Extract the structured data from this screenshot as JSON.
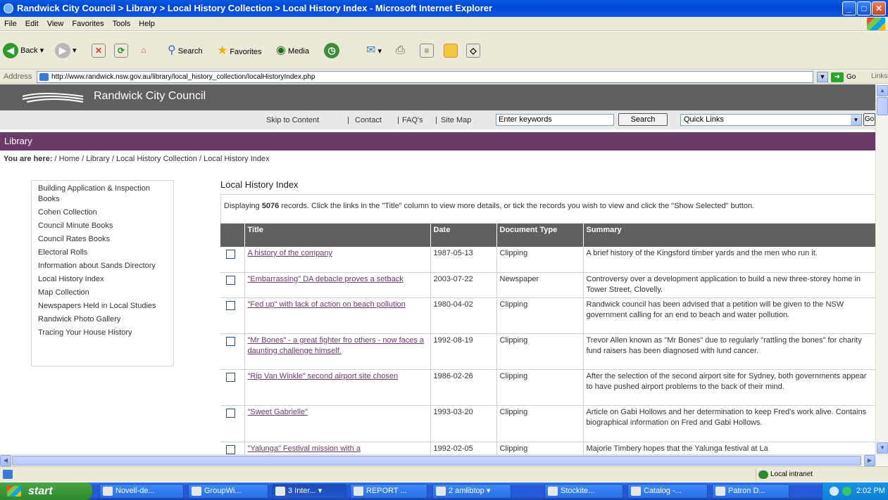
{
  "window": {
    "title": "Randwick City Council > Library > Local History Collection > Local History Index - Microsoft Internet Explorer"
  },
  "menu": [
    "File",
    "Edit",
    "View",
    "Favorites",
    "Tools",
    "Help"
  ],
  "toolbar": {
    "back": "Back",
    "search": "Search",
    "favorites": "Favorites",
    "media": "Media"
  },
  "address": {
    "label": "Address",
    "url": "http://www.randwick.nsw.gov.au/library/local_history_collection/localHistoryIndex.php",
    "go": "Go",
    "links": "Links"
  },
  "site": {
    "name": "Randwick City Council",
    "util": {
      "skip": "Skip to Content",
      "contact": "Contact",
      "faq": "FAQ's",
      "sitemap": "Site Map"
    },
    "search_value": "Enter keywords",
    "search_button": "Search",
    "quick_links": "Quick Links",
    "go_button": "Go",
    "section": "Library",
    "breadcrumb": {
      "label": "You are here:",
      "items": [
        "Home",
        "Library",
        "Local History Collection",
        "Local History Index"
      ]
    }
  },
  "sidebar": {
    "items": [
      "Building Application & Inspection Books",
      "Cohen Collection",
      "Council Minute Books",
      "Council Rates Books",
      "Electoral Rolls",
      "Information about Sands Directory",
      "Local History Index",
      "Map Collection",
      "Newspapers Held in Local Studies",
      "Randwick Photo Gallery",
      "Tracing Your House History"
    ]
  },
  "main": {
    "title": "Local History Index",
    "intro_prefix": "Displaying ",
    "record_count": "5076",
    "intro_suffix": " records. Click the links in the \"Title\" column to view more details, or tick the records you wish to view and click the \"Show Selected\" button.",
    "columns": {
      "title": "Title",
      "date": "Date",
      "doctype": "Document Type",
      "summary": "Summary"
    },
    "rows": [
      {
        "title": "A history of the company",
        "date": "1987-05-13",
        "type": "Clipping",
        "summary": "A brief history of the Kingsford timber yards and the men who run it."
      },
      {
        "title": "\"Embarrassing\" DA debacle proves a setback",
        "date": "2003-07-22",
        "type": "Newspaper",
        "summary": "Controversy over a development application to build a new three-storey home in Tower Street, Clovelly."
      },
      {
        "title": "\"Fed up\" with lack of action on beach pollution",
        "date": "1980-04-02",
        "type": "Clipping",
        "summary": "Randwick council has been advised that a petition will be given to the NSW government calling for an end to beach and water pollution."
      },
      {
        "title": "\"Mr Bones\" - a great fighter fro others - now faces a daunting challenge himself.",
        "date": "1992-08-19",
        "type": "Clipping",
        "summary": "Trevor Allen known as \"Mr Bones\" due to regularly \"rattling the bones\" for charity fund raisers has been diagnosed with lund cancer."
      },
      {
        "title": "\"Rip Van Winkle\" second airport site chosen",
        "date": "1986-02-26",
        "type": "Clipping",
        "summary": "After the selection of the second airport site for Sydney, both governments appear to have pushed airport problems to the back of their mind."
      },
      {
        "title": "\"Sweet Gabrielle\"",
        "date": "1993-03-20",
        "type": "Clipping",
        "summary": "Article on Gabi Hollows and her determination to keep Fred's work alive. Contains biographical information on Fred and Gabi Hollows."
      },
      {
        "title": "\"Yalunga\" Festival mission with a",
        "date": "1992-02-05",
        "type": "Clipping",
        "summary": "Majorie Timbery hopes that the Yalunga festival at La"
      }
    ]
  },
  "status": {
    "zone": "Local intranet"
  },
  "taskbar": {
    "start": "start",
    "tasks": [
      "Novell-de...",
      "GroupWi...",
      "3 Inter...",
      "REPORT ...",
      "2 amlibtop",
      "Stockite...",
      "Catalog -...",
      "Patron D..."
    ],
    "clock": "2:02 PM"
  }
}
